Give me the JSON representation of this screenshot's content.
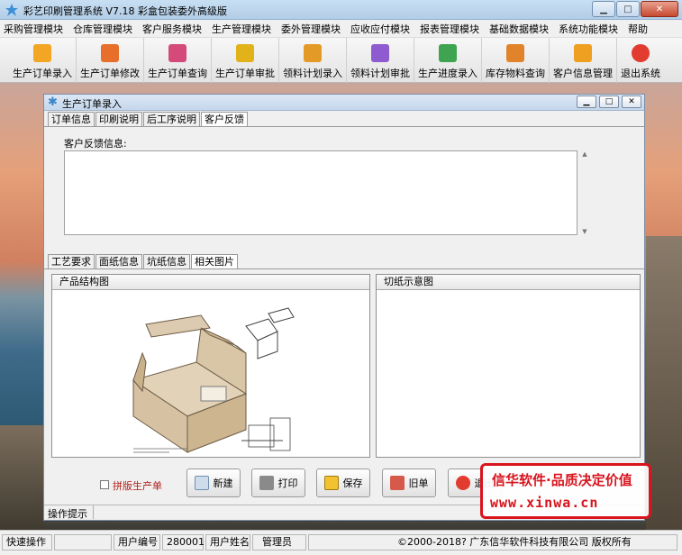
{
  "window": {
    "title": "彩艺印刷管理系统   V7.18 彩盒包装委外高级版"
  },
  "menu": [
    "采购管理模块",
    "仓库管理模块",
    "客户服务模块",
    "生产管理模块",
    "委外管理模块",
    "应收应付模块",
    "报表管理模块",
    "基础数据模块",
    "系统功能模块",
    "帮助"
  ],
  "toolbar": [
    {
      "label": "生产订单录入",
      "icon": "order-entry-icon",
      "color": "#f2a623"
    },
    {
      "label": "生产订单修改",
      "icon": "order-edit-icon",
      "color": "#e86f2b"
    },
    {
      "label": "生产订单查询",
      "icon": "order-query-icon",
      "color": "#d44a7a"
    },
    {
      "label": "生产订单审批",
      "icon": "order-approve-icon",
      "color": "#e2b21b"
    },
    {
      "label": "领料计划录入",
      "icon": "material-plan-icon",
      "color": "#e49a27"
    },
    {
      "label": "领料计划审批",
      "icon": "material-approve-icon",
      "color": "#8e5bd0"
    },
    {
      "label": "生产进度录入",
      "icon": "progress-icon",
      "color": "#3fa44f"
    },
    {
      "label": "库存物料查询",
      "icon": "inventory-icon",
      "color": "#e0832a"
    },
    {
      "label": "客户信息管理",
      "icon": "customer-icon",
      "color": "#f0a020"
    },
    {
      "label": "退出系统",
      "icon": "exit-icon",
      "color": "#e23b2f"
    }
  ],
  "child": {
    "title": "生产订单录入",
    "tabs_top": [
      "订单信息",
      "印刷说明",
      "后工序说明",
      "客户反馈"
    ],
    "feedback_label": "客户反馈信息:",
    "tabs_bottom": [
      "工艺要求",
      "面纸信息",
      "坑纸信息",
      "相关图片"
    ],
    "panel_left": "产品结构图",
    "panel_right": "切纸示意图",
    "checkbox_label": "拼版生产单",
    "buttons": [
      "新建",
      "打印",
      "保存",
      "旧单",
      "退出"
    ],
    "op_hint": "操作提示"
  },
  "status": {
    "quick": "快速操作",
    "user_no_label": "用户编号",
    "user_no": "280001",
    "user_name_label": "用户姓名",
    "user_name": "管理员",
    "copyright": "©2000-2018?   广东信华软件科技有限公司   版权所有"
  },
  "brand": {
    "line1": "信华软件·品质决定价值",
    "line2": "www.xinwa.cn"
  }
}
